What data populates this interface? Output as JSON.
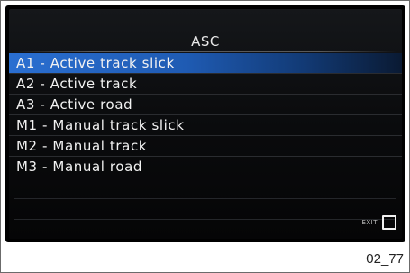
{
  "screen": {
    "title": "ASC",
    "menu_items": [
      {
        "label": "A1 - Active track slick",
        "selected": true
      },
      {
        "label": "A2 - Active track",
        "selected": false
      },
      {
        "label": "A3 - Active road",
        "selected": false
      },
      {
        "label": "M1 - Manual track slick",
        "selected": false
      },
      {
        "label": "M2 - Manual track",
        "selected": false
      },
      {
        "label": "M3 - Manual road",
        "selected": false
      }
    ],
    "exit_label": "EXIT"
  },
  "figure": {
    "reference_code": "02_77"
  },
  "colors": {
    "selection": "#2a6fd1",
    "background": "#000000",
    "text": "#f2f2f2"
  },
  "icons": {
    "exit": "checkbox-square-icon"
  }
}
